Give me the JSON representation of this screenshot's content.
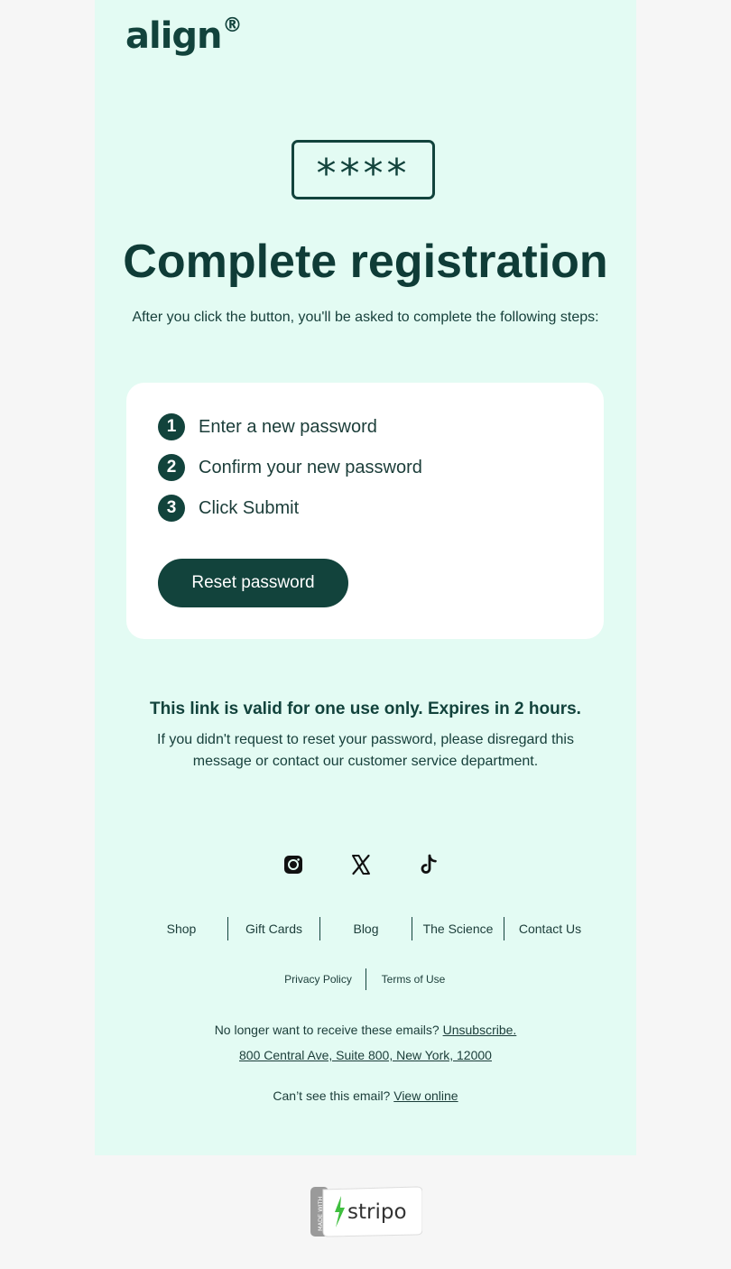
{
  "brand": {
    "logo_text": "align",
    "logo_mark": "®"
  },
  "hero": {
    "password_mask": "****",
    "title": "Complete registration",
    "intro": "After you click the button, you'll be asked to complete the following steps:"
  },
  "steps": [
    {
      "number": "1",
      "label": "Enter a new password"
    },
    {
      "number": "2",
      "label": "Confirm your new password"
    },
    {
      "number": "3",
      "label": "Click Submit"
    }
  ],
  "cta": {
    "label": "Reset password"
  },
  "notice": {
    "validity": "This link is valid for one use only. Expires in 2 hours.",
    "disregard": "If you didn't request to reset your password, please disregard this message or contact our customer service department."
  },
  "social": [
    {
      "icon": "instagram-icon"
    },
    {
      "icon": "x-icon"
    },
    {
      "icon": "tiktok-icon"
    }
  ],
  "nav": [
    "Shop",
    "Gift Cards",
    "Blog",
    "The Science",
    "Contact Us"
  ],
  "legal": [
    "Privacy Policy",
    "Terms of Use"
  ],
  "footer": {
    "unsubscribe_prefix": "No longer want to receive these emails?",
    "unsubscribe_link": "Unsubscribe.",
    "address": "800 Central Ave, Suite 800, New York, 12000",
    "view_online_prefix": "Can’t see this email?",
    "view_online_link": "View online"
  },
  "badge": {
    "made_with": "MADE WITH",
    "name": "stripo"
  },
  "colors": {
    "page_bg": "#f6f6f6",
    "email_bg": "#e3fbf3",
    "primary": "#12433c",
    "card_bg": "#ffffff",
    "stripo_green": "#3fbf3f"
  }
}
